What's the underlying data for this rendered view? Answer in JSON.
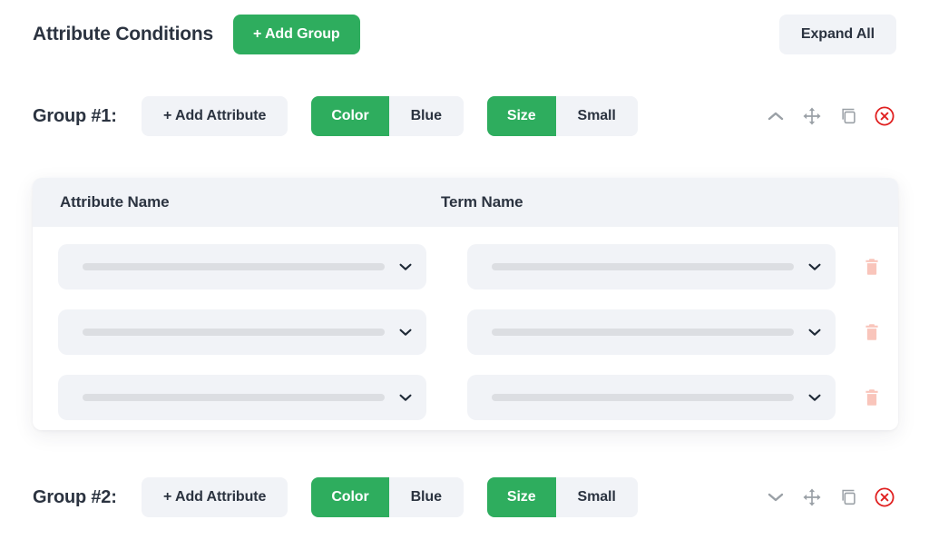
{
  "header": {
    "title": "Attribute Conditions",
    "add_group_label": "+ Add Group",
    "expand_all_label": "Expand All"
  },
  "colors": {
    "accent_green": "#2EAD5E",
    "neutral_chip": "#f1f3f7",
    "text_dark": "#2b3340",
    "icon_gray": "#9aa0a6",
    "delete_red": "#e02020",
    "trash_pink": "#f9c5bb",
    "skeleton_gray": "#dcdee2"
  },
  "groups": [
    {
      "label": "Group #1:",
      "add_attribute_label": "+ Add Attribute",
      "expanded": true,
      "pills": [
        {
          "key": "Color",
          "value": "Blue"
        },
        {
          "key": "Size",
          "value": "Small"
        }
      ],
      "actions": [
        {
          "name": "collapse-group-icon",
          "icon": "chevron-up"
        },
        {
          "name": "move-group-icon",
          "icon": "move-arrows"
        },
        {
          "name": "duplicate-group-icon",
          "icon": "copy"
        },
        {
          "name": "delete-group-icon",
          "icon": "circle-x"
        }
      ]
    },
    {
      "label": "Group #2:",
      "add_attribute_label": "+ Add Attribute",
      "expanded": false,
      "pills": [
        {
          "key": "Color",
          "value": "Blue"
        },
        {
          "key": "Size",
          "value": "Small"
        }
      ],
      "actions": [
        {
          "name": "expand-group-icon",
          "icon": "chevron-down"
        },
        {
          "name": "move-group-icon",
          "icon": "move-arrows"
        },
        {
          "name": "duplicate-group-icon",
          "icon": "copy"
        },
        {
          "name": "delete-group-icon",
          "icon": "circle-x"
        }
      ]
    }
  ],
  "attribute_table": {
    "columns": [
      "Attribute Name",
      "Term Name"
    ],
    "rows": [
      {
        "attribute_name": "",
        "term_name": ""
      },
      {
        "attribute_name": "",
        "term_name": ""
      },
      {
        "attribute_name": "",
        "term_name": ""
      }
    ]
  }
}
